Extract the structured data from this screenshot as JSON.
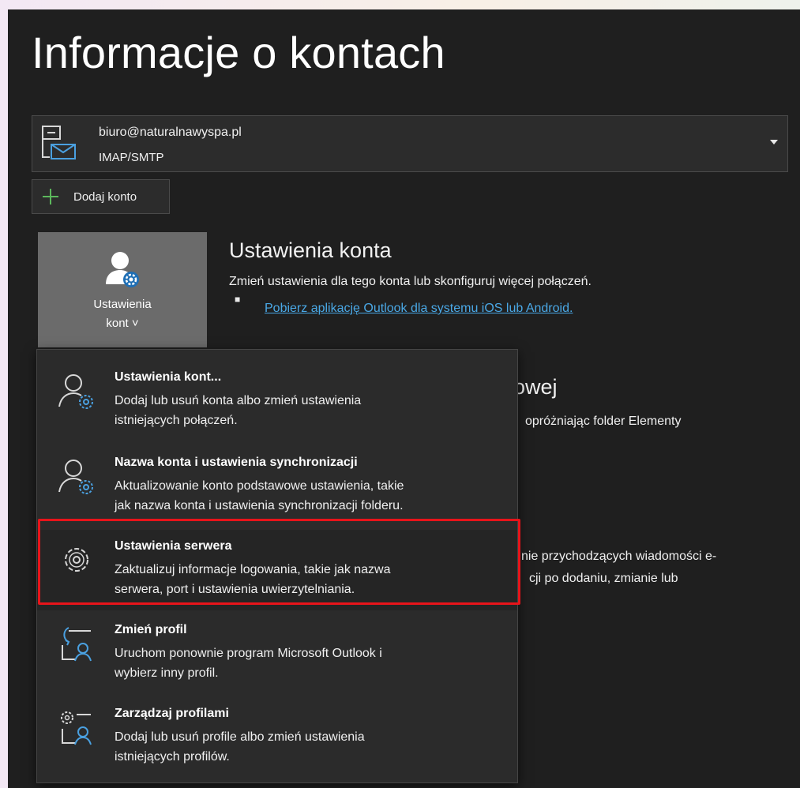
{
  "page": {
    "title": "Informacje o kontach"
  },
  "account": {
    "email": "biuro@naturalnawyspa.pl",
    "type": "IMAP/SMTP"
  },
  "add_account": {
    "label": "Dodaj konto"
  },
  "account_settings_tile": {
    "line1": "Ustawienia",
    "line2": "kont ˅"
  },
  "account_settings_section": {
    "title": "Ustawienia konta",
    "description": "Zmień ustawienia dla tego konta lub skonfiguruj więcej połączeń.",
    "bullet": "■",
    "link": "Pobierz aplikację Outlook dla systemu iOS lub Android."
  },
  "background_fragments": {
    "heading": "owej",
    "line1": "opróżniając folder Elementy",
    "line2": "nie przychodzących wiadomości e-",
    "line3": "cji po dodaniu, zmianie lub"
  },
  "menu": {
    "items": [
      {
        "title": "Ustawienia kont...",
        "desc1": "Dodaj lub usuń konta albo zmień ustawienia",
        "desc2": "istniejących połączeń.",
        "icon": "person-gear-icon"
      },
      {
        "title": "Nazwa konta i ustawienia synchronizacji",
        "desc1": "Aktualizowanie konto podstawowe ustawienia, takie",
        "desc2": "jak nazwa konta i ustawienia synchronizacji folderu.",
        "icon": "person-gear-icon"
      },
      {
        "title": "Ustawienia serwera",
        "desc1": "Zaktualizuj informacje logowania, takie jak nazwa",
        "desc2": "serwera, port i ustawienia uwierzytelniania.",
        "icon": "gear-icon"
      },
      {
        "title": "Zmień profil",
        "desc1": "Uruchom ponownie program Microsoft Outlook i",
        "desc2": "wybierz inny profil.",
        "icon": "switch-profile-icon"
      },
      {
        "title": "Zarządzaj profilami",
        "desc1": "Dodaj lub usuń profile albo zmień ustawienia",
        "desc2": "istniejących profilów.",
        "icon": "manage-profiles-icon"
      }
    ]
  },
  "colors": {
    "background": "#1f1f1f",
    "menu_background": "#2b2b2b",
    "tile_background": "#6b6b6b",
    "link": "#4aa8e6",
    "accent_icon": "#4aa0e0",
    "highlight_border": "#e8141a",
    "plus_green": "#5cb85c"
  }
}
